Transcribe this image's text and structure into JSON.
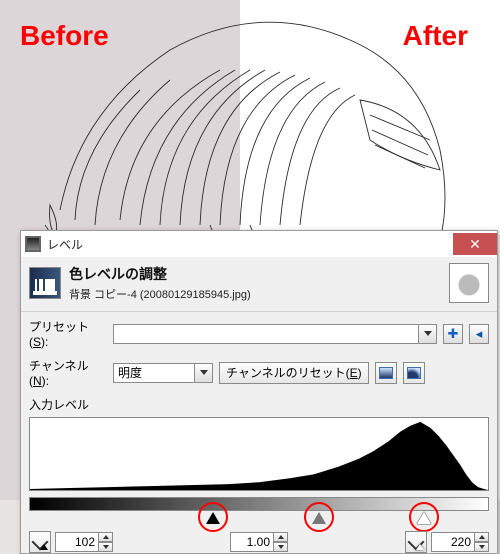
{
  "annotations": {
    "before": "Before",
    "after": "After"
  },
  "dialog": {
    "title": "レベル",
    "header_title": "色レベルの調整",
    "header_sub": "背景 コピー-4 (20080129185945.jpg)",
    "preset_label_pre": "プリセット(",
    "preset_label_ul": "S",
    "preset_label_post": "):",
    "preset_value": "",
    "add_btn": "✚",
    "menu_btn": "◂",
    "channel_label_pre": "チャンネル(",
    "channel_label_ul": "N",
    "channel_label_post": "):",
    "channel_value": "明度",
    "reset_channel_pre": "チャンネルのリセット(",
    "reset_channel_ul": "E",
    "reset_channel_post": ")",
    "input_levels_label": "入力レベル",
    "values": {
      "black": "102",
      "gamma": "1.00",
      "white": "220"
    },
    "slider_positions": {
      "black_pct": 40,
      "gray_pct": 63,
      "white_pct": 86
    },
    "icons": {
      "app": "gimp-icon",
      "close": "close-icon",
      "histogram_header": "histogram-icon",
      "thumbnail": "thumbnail-icon",
      "add": "add-icon",
      "menu": "menu-icon",
      "linear": "linear-scale-icon",
      "log": "log-scale-icon",
      "eyedropper_black": "eyedropper-black-icon",
      "eyedropper_white": "eyedropper-white-icon"
    }
  }
}
